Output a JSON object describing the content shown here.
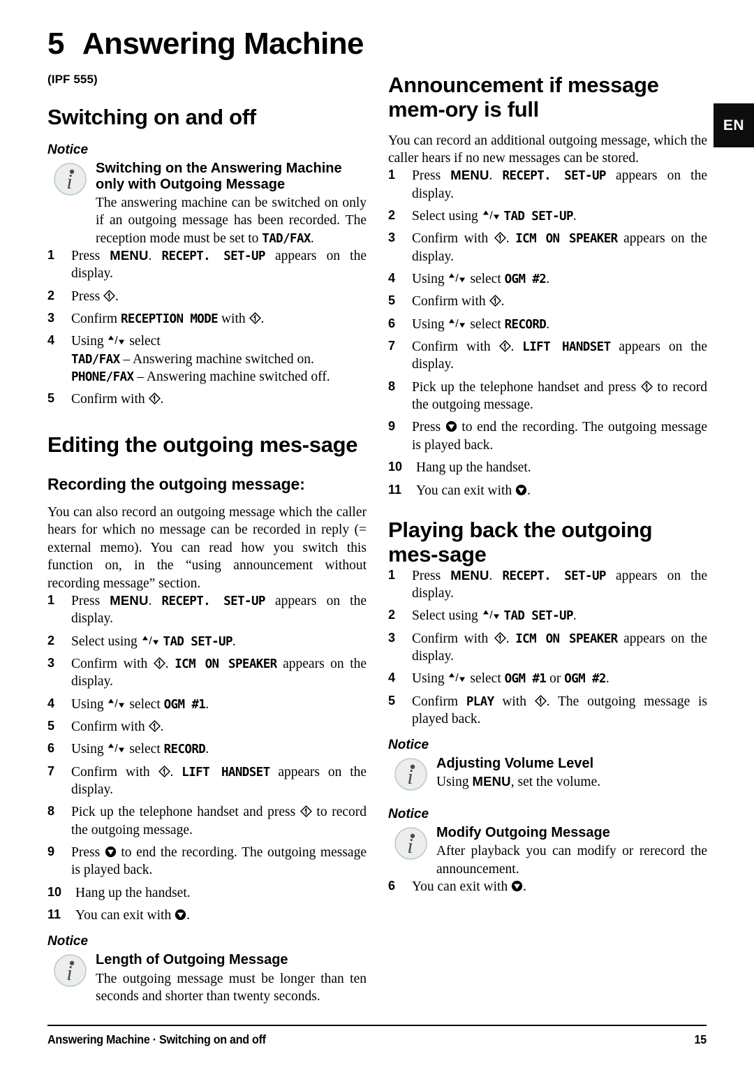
{
  "lang_tab": "EN",
  "chapter": {
    "number": "5",
    "title": "Answering Machine",
    "model": "(IPF 555)"
  },
  "footer": {
    "left": "Answering Machine · Switching on and off",
    "page": "15"
  },
  "left_column": {
    "section1": {
      "heading": "Switching on and off",
      "notice": {
        "label": "Notice",
        "title": "Switching on the Answering Machine only with Outgoing Message",
        "text_a": "The answering machine can be switched on only if an outgoing message has been recorded. The reception mode must be set to ",
        "lcd_a": "TAD/FAX",
        "text_b": "."
      },
      "steps": [
        {
          "num": "1",
          "parts": [
            {
              "t": "text",
              "v": "Press "
            },
            {
              "t": "key",
              "v": "MENU"
            },
            {
              "t": "text",
              "v": ". "
            },
            {
              "t": "lcd",
              "v": "RECEPT. SET-UP"
            },
            {
              "t": "text",
              "v": " appears on the display."
            }
          ]
        },
        {
          "num": "2",
          "parts": [
            {
              "t": "text",
              "v": "Press "
            },
            {
              "t": "icon",
              "v": "ok-diamond-icon"
            },
            {
              "t": "text",
              "v": "."
            }
          ]
        },
        {
          "num": "3",
          "parts": [
            {
              "t": "text",
              "v": "Confirm "
            },
            {
              "t": "lcd",
              "v": "RECEPTION MODE"
            },
            {
              "t": "text",
              "v": " with "
            },
            {
              "t": "icon",
              "v": "ok-diamond-icon"
            },
            {
              "t": "text",
              "v": "."
            }
          ]
        },
        {
          "num": "4",
          "parts": [
            {
              "t": "text",
              "v": "Using "
            },
            {
              "t": "arrows",
              "v": "up-down-arrows-icon"
            },
            {
              "t": "text",
              "v": " select"
            },
            {
              "t": "br",
              "v": ""
            },
            {
              "t": "lcd",
              "v": "TAD/FAX"
            },
            {
              "t": "text",
              "v": " – Answering machine switched on."
            },
            {
              "t": "br",
              "v": ""
            },
            {
              "t": "lcd",
              "v": "PHONE/FAX"
            },
            {
              "t": "text",
              "v": " – Answering machine switched off."
            }
          ]
        },
        {
          "num": "5",
          "parts": [
            {
              "t": "text",
              "v": "Confirm with "
            },
            {
              "t": "icon",
              "v": "ok-diamond-icon"
            },
            {
              "t": "text",
              "v": "."
            }
          ]
        }
      ]
    },
    "section2": {
      "heading": "Editing the outgoing mes-​sage",
      "subheading": "Recording the outgoing message:",
      "intro": "You can also record an outgoing message which the caller hears for which no message can be recorded in reply (= external memo). You can read how you switch this function on, in the “using announcement without recording message” section.",
      "steps": [
        {
          "num": "1",
          "parts": [
            {
              "t": "text",
              "v": "Press "
            },
            {
              "t": "key",
              "v": "MENU"
            },
            {
              "t": "text",
              "v": ". "
            },
            {
              "t": "lcd",
              "v": "RECEPT. SET-UP"
            },
            {
              "t": "text",
              "v": " appears on the display."
            }
          ]
        },
        {
          "num": "2",
          "parts": [
            {
              "t": "text",
              "v": "Select using "
            },
            {
              "t": "arrows",
              "v": "up-down-arrows-icon"
            },
            {
              "t": "text",
              "v": " "
            },
            {
              "t": "lcd",
              "v": "TAD SET-UP"
            },
            {
              "t": "text",
              "v": "."
            }
          ]
        },
        {
          "num": "3",
          "parts": [
            {
              "t": "text",
              "v": "Confirm with "
            },
            {
              "t": "icon",
              "v": "ok-diamond-icon"
            },
            {
              "t": "text",
              "v": ". "
            },
            {
              "t": "lcd",
              "v": "ICM ON SPEAKER"
            },
            {
              "t": "text",
              "v": " appears on the display."
            }
          ]
        },
        {
          "num": "4",
          "parts": [
            {
              "t": "text",
              "v": "Using "
            },
            {
              "t": "arrows",
              "v": "up-down-arrows-icon"
            },
            {
              "t": "text",
              "v": " select "
            },
            {
              "t": "lcd",
              "v": "OGM #1"
            },
            {
              "t": "text",
              "v": "."
            }
          ]
        },
        {
          "num": "5",
          "parts": [
            {
              "t": "text",
              "v": "Confirm with "
            },
            {
              "t": "icon",
              "v": "ok-diamond-icon"
            },
            {
              "t": "text",
              "v": "."
            }
          ]
        },
        {
          "num": "6",
          "parts": [
            {
              "t": "text",
              "v": "Using "
            },
            {
              "t": "arrows",
              "v": "up-down-arrows-icon"
            },
            {
              "t": "text",
              "v": " select "
            },
            {
              "t": "lcd",
              "v": "RECORD"
            },
            {
              "t": "text",
              "v": "."
            }
          ]
        },
        {
          "num": "7",
          "parts": [
            {
              "t": "text",
              "v": "Confirm with "
            },
            {
              "t": "icon",
              "v": "ok-diamond-icon"
            },
            {
              "t": "text",
              "v": ". "
            },
            {
              "t": "lcd",
              "v": "LIFT HANDSET"
            },
            {
              "t": "text",
              "v": " appears on the display."
            }
          ]
        },
        {
          "num": "8",
          "parts": [
            {
              "t": "text",
              "v": "Pick up the telephone handset and press "
            },
            {
              "t": "icon",
              "v": "ok-diamond-icon"
            },
            {
              "t": "text",
              "v": " to record the outgoing message."
            }
          ]
        },
        {
          "num": "9",
          "parts": [
            {
              "t": "text",
              "v": "Press "
            },
            {
              "t": "icon",
              "v": "stop-circle-icon"
            },
            {
              "t": "text",
              "v": " to end the recording. The outgoing message is played back."
            }
          ]
        },
        {
          "num": "10",
          "parts": [
            {
              "t": "text",
              "v": "Hang up the handset."
            }
          ]
        },
        {
          "num": "11",
          "parts": [
            {
              "t": "text",
              "v": "You can exit with "
            },
            {
              "t": "icon",
              "v": "stop-circle-icon"
            },
            {
              "t": "text",
              "v": "."
            }
          ]
        }
      ],
      "notice": {
        "label": "Notice",
        "title": "Length of Outgoing Message",
        "text_a": "The outgoing message must be longer than ten seconds and shorter than twenty seconds.",
        "lcd_a": "",
        "text_b": ""
      }
    }
  },
  "right_column": {
    "section1": {
      "heading": "Announcement if message mem-​ory is full",
      "intro": "You can record an additional outgoing message, which the caller hears if no new messages can be stored.",
      "steps": [
        {
          "num": "1",
          "parts": [
            {
              "t": "text",
              "v": "Press "
            },
            {
              "t": "key",
              "v": "MENU"
            },
            {
              "t": "text",
              "v": ". "
            },
            {
              "t": "lcd",
              "v": "RECEPT. SET-UP"
            },
            {
              "t": "text",
              "v": " appears on the display."
            }
          ]
        },
        {
          "num": "2",
          "parts": [
            {
              "t": "text",
              "v": "Select using "
            },
            {
              "t": "arrows",
              "v": "up-down-arrows-icon"
            },
            {
              "t": "text",
              "v": " "
            },
            {
              "t": "lcd",
              "v": "TAD SET-UP"
            },
            {
              "t": "text",
              "v": "."
            }
          ]
        },
        {
          "num": "3",
          "parts": [
            {
              "t": "text",
              "v": "Confirm with "
            },
            {
              "t": "icon",
              "v": "ok-diamond-icon"
            },
            {
              "t": "text",
              "v": ". "
            },
            {
              "t": "lcd",
              "v": "ICM ON SPEAKER"
            },
            {
              "t": "text",
              "v": " appears on the display."
            }
          ]
        },
        {
          "num": "4",
          "parts": [
            {
              "t": "text",
              "v": "Using "
            },
            {
              "t": "arrows",
              "v": "up-down-arrows-icon"
            },
            {
              "t": "text",
              "v": " select "
            },
            {
              "t": "lcd",
              "v": "OGM #2"
            },
            {
              "t": "text",
              "v": "."
            }
          ]
        },
        {
          "num": "5",
          "parts": [
            {
              "t": "text",
              "v": "Confirm with "
            },
            {
              "t": "icon",
              "v": "ok-diamond-icon"
            },
            {
              "t": "text",
              "v": "."
            }
          ]
        },
        {
          "num": "6",
          "parts": [
            {
              "t": "text",
              "v": "Using "
            },
            {
              "t": "arrows",
              "v": "up-down-arrows-icon"
            },
            {
              "t": "text",
              "v": " select "
            },
            {
              "t": "lcd",
              "v": "RECORD"
            },
            {
              "t": "text",
              "v": "."
            }
          ]
        },
        {
          "num": "7",
          "parts": [
            {
              "t": "text",
              "v": "Confirm with "
            },
            {
              "t": "icon",
              "v": "ok-diamond-icon"
            },
            {
              "t": "text",
              "v": ". "
            },
            {
              "t": "lcd",
              "v": "LIFT HANDSET"
            },
            {
              "t": "text",
              "v": " appears on the display."
            }
          ]
        },
        {
          "num": "8",
          "parts": [
            {
              "t": "text",
              "v": "Pick up the telephone handset and press "
            },
            {
              "t": "icon",
              "v": "ok-diamond-icon"
            },
            {
              "t": "text",
              "v": " to record the outgoing message."
            }
          ]
        },
        {
          "num": "9",
          "parts": [
            {
              "t": "text",
              "v": "Press "
            },
            {
              "t": "icon",
              "v": "stop-circle-icon"
            },
            {
              "t": "text",
              "v": " to end the recording. The outgoing message is played back."
            }
          ]
        },
        {
          "num": "10",
          "parts": [
            {
              "t": "text",
              "v": "Hang up the handset."
            }
          ]
        },
        {
          "num": "11",
          "parts": [
            {
              "t": "text",
              "v": "You can exit with "
            },
            {
              "t": "icon",
              "v": "stop-circle-icon"
            },
            {
              "t": "text",
              "v": "."
            }
          ]
        }
      ]
    },
    "section2": {
      "heading": "Playing back the outgoing mes-​sage",
      "steps": [
        {
          "num": "1",
          "parts": [
            {
              "t": "text",
              "v": "Press "
            },
            {
              "t": "key",
              "v": "MENU"
            },
            {
              "t": "text",
              "v": ". "
            },
            {
              "t": "lcd",
              "v": "RECEPT. SET-UP"
            },
            {
              "t": "text",
              "v": " appears on the display."
            }
          ]
        },
        {
          "num": "2",
          "parts": [
            {
              "t": "text",
              "v": "Select using "
            },
            {
              "t": "arrows",
              "v": "up-down-arrows-icon"
            },
            {
              "t": "text",
              "v": " "
            },
            {
              "t": "lcd",
              "v": "TAD SET-UP"
            },
            {
              "t": "text",
              "v": "."
            }
          ]
        },
        {
          "num": "3",
          "parts": [
            {
              "t": "text",
              "v": "Confirm with "
            },
            {
              "t": "icon",
              "v": "ok-diamond-icon"
            },
            {
              "t": "text",
              "v": ". "
            },
            {
              "t": "lcd",
              "v": "ICM ON SPEAKER"
            },
            {
              "t": "text",
              "v": " appears on the display."
            }
          ]
        },
        {
          "num": "4",
          "parts": [
            {
              "t": "text",
              "v": "Using "
            },
            {
              "t": "arrows",
              "v": "up-down-arrows-icon"
            },
            {
              "t": "text",
              "v": " select "
            },
            {
              "t": "lcd",
              "v": "OGM #1"
            },
            {
              "t": "text",
              "v": " or "
            },
            {
              "t": "lcd",
              "v": "OGM #2"
            },
            {
              "t": "text",
              "v": "."
            }
          ]
        },
        {
          "num": "5",
          "parts": [
            {
              "t": "text",
              "v": "Confirm "
            },
            {
              "t": "lcd",
              "v": "PLAY"
            },
            {
              "t": "text",
              "v": " with "
            },
            {
              "t": "icon",
              "v": "ok-diamond-icon"
            },
            {
              "t": "text",
              "v": ". The outgoing message is played back."
            }
          ]
        }
      ],
      "notice_volume": {
        "label": "Notice",
        "title": "Adjusting Volume Level",
        "text_a": "Using ",
        "key_a": "MENU",
        "text_b": ", set the volume."
      },
      "notice_modify": {
        "label": "Notice",
        "title": "Modify Outgoing Message",
        "text_a": "After playback you can modify or rerecord the announcement."
      },
      "last_step": {
        "num": "6",
        "parts": [
          {
            "t": "text",
            "v": "You can exit with "
          },
          {
            "t": "icon",
            "v": "stop-circle-icon"
          },
          {
            "t": "text",
            "v": "."
          }
        ]
      }
    }
  }
}
